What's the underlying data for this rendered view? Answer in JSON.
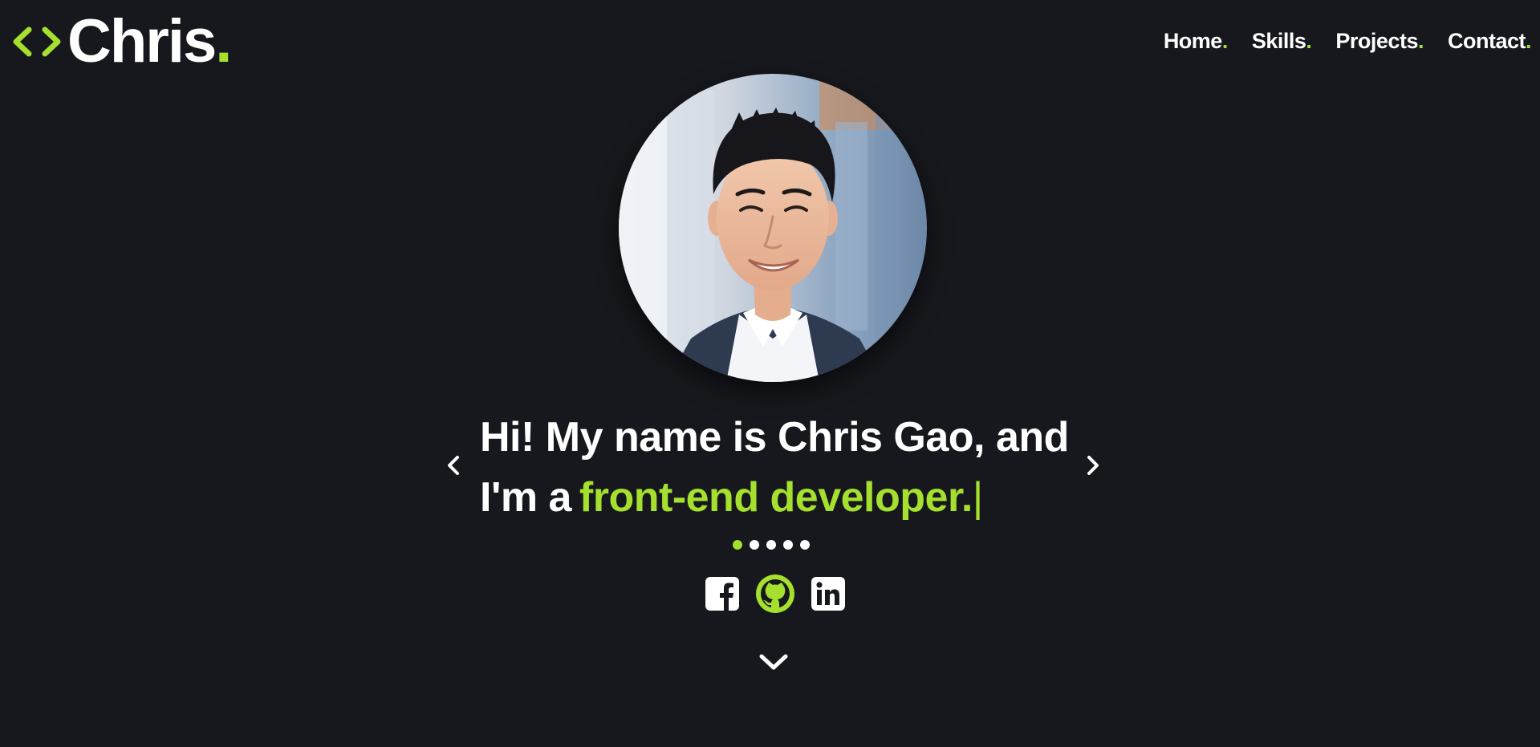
{
  "colors": {
    "background": "#17181d",
    "accent": "#a4e02d",
    "text": "#ffffff"
  },
  "header": {
    "logo": {
      "icon": "code-brackets-icon",
      "text": "Chris",
      "dot": "."
    },
    "nav": [
      {
        "label": "Home",
        "dot": "."
      },
      {
        "label": "Skills",
        "dot": "."
      },
      {
        "label": "Projects",
        "dot": "."
      },
      {
        "label": "Contact",
        "dot": "."
      }
    ]
  },
  "hero": {
    "avatar_icon": "profile-photo",
    "headline_line1": "Hi! My name is Chris Gao, and",
    "headline_prefix": "I'm a",
    "headline_role": "front-end developer.",
    "cursor": "|",
    "prev_icon": "chevron-left-icon",
    "next_icon": "chevron-right-icon",
    "slide_count": 5,
    "active_slide": 1,
    "socials": [
      {
        "icon": "facebook-icon",
        "active": false
      },
      {
        "icon": "github-icon",
        "active": true
      },
      {
        "icon": "linkedin-icon",
        "active": false
      }
    ],
    "scroll_icon": "chevron-down-icon"
  }
}
